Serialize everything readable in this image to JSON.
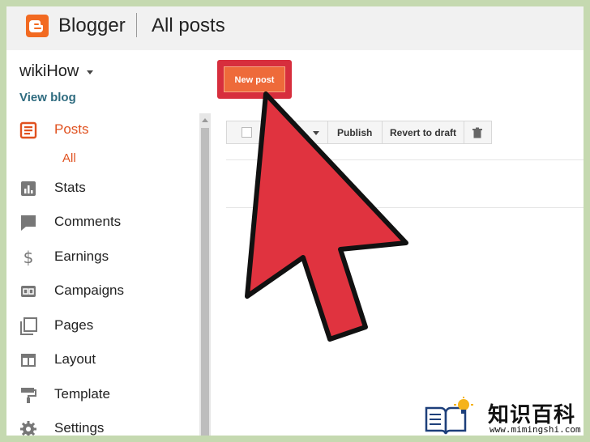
{
  "header": {
    "app_name": "Blogger",
    "page_title": "All posts"
  },
  "blog": {
    "name": "wikiHow",
    "view_blog_label": "View blog"
  },
  "sidebar": {
    "items": [
      {
        "label": "Posts",
        "icon": "posts-icon",
        "active": true
      },
      {
        "label": "Stats",
        "icon": "stats-icon"
      },
      {
        "label": "Comments",
        "icon": "comments-icon"
      },
      {
        "label": "Earnings",
        "icon": "dollar-icon"
      },
      {
        "label": "Campaigns",
        "icon": "ad-icon"
      },
      {
        "label": "Pages",
        "icon": "pages-icon"
      },
      {
        "label": "Layout",
        "icon": "layout-icon"
      },
      {
        "label": "Template",
        "icon": "paint-roller-icon"
      },
      {
        "label": "Settings",
        "icon": "gear-icon"
      }
    ],
    "posts_sub_item": "All"
  },
  "main": {
    "new_post_label": "New post",
    "toolbar": {
      "publish_label": "Publish",
      "revert_label": "Revert to draft"
    }
  },
  "watermark": {
    "title": "知识百科",
    "url": "www.mimingshi.com"
  },
  "colors": {
    "accent": "#e0511f",
    "highlight": "#d72e3d",
    "arrow": "#e0333f",
    "link": "#2e6b7f"
  }
}
